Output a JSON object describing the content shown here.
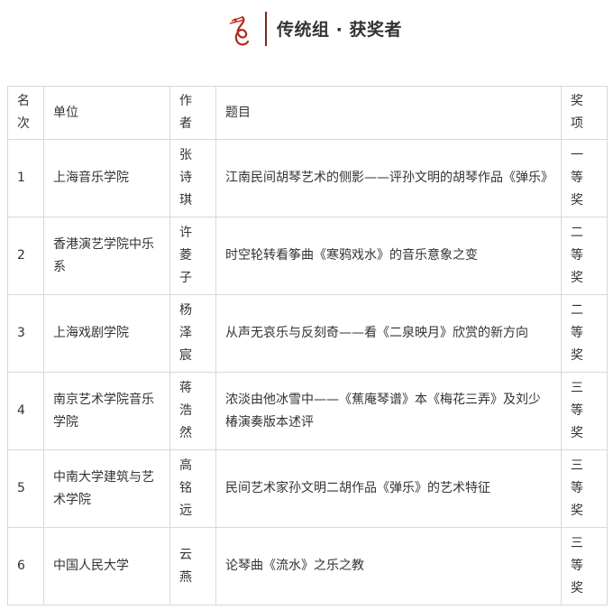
{
  "header": {
    "title": "传统组 · 获奖者"
  },
  "table": {
    "columns": {
      "rank": "名次",
      "unit": "单位",
      "author": "作者",
      "topic": "题目",
      "award": "奖项"
    },
    "rows": [
      {
        "rank": "1",
        "unit": "上海音乐学院",
        "author": "张诗琪",
        "topic": "江南民间胡琴艺术的侧影——评孙文明的胡琴作品《弹乐》",
        "award": "一等奖"
      },
      {
        "rank": "2",
        "unit": "香港演艺学院中乐系",
        "author": "许菱子",
        "topic": "时空轮转看筝曲《寒鸦戏水》的音乐意象之变",
        "award": "二等奖"
      },
      {
        "rank": "3",
        "unit": "上海戏剧学院",
        "author": "杨泽宸",
        "topic": "从声无哀乐与反刻奇——看《二泉映月》欣赏的新方向",
        "award": "二等奖"
      },
      {
        "rank": "4",
        "unit": "南京艺术学院音乐学院",
        "author": "蒋浩然",
        "topic": "浓淡由他冰雪中——《蕉庵琴谱》本《梅花三弄》及刘少椿演奏版本述评",
        "award": "三等奖"
      },
      {
        "rank": "5",
        "unit": "中南大学建筑与艺术学院",
        "author": "高铭远",
        "topic": "民间艺术家孙文明二胡作品《弹乐》的艺术特征",
        "award": "三等奖"
      },
      {
        "rank": "6",
        "unit": "中国人民大学",
        "author": "云燕",
        "topic": "论琴曲《流水》之乐之教",
        "award": "三等奖"
      }
    ]
  }
}
